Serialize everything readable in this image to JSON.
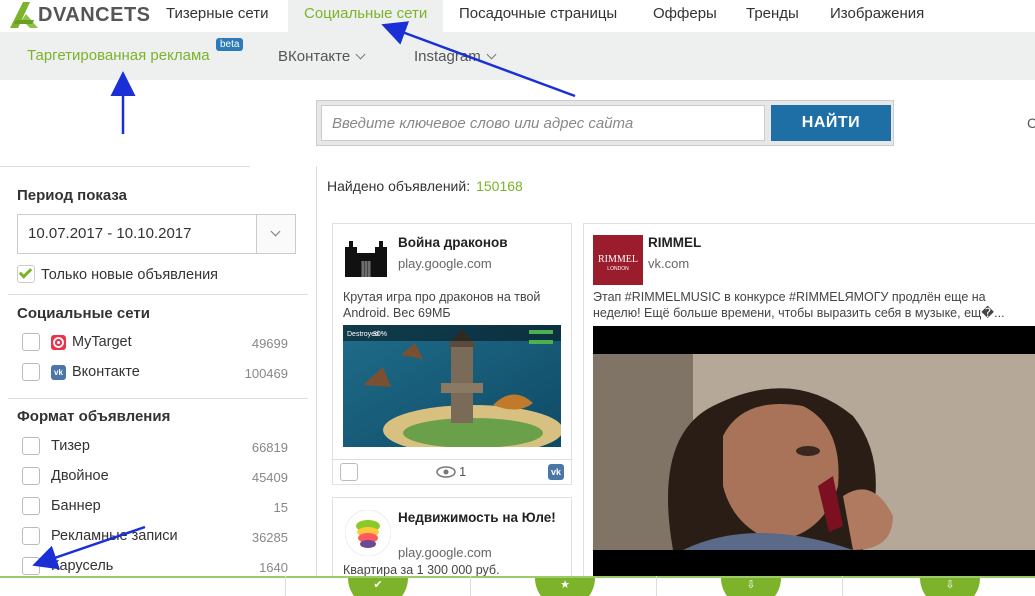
{
  "app": {
    "logo_letter": "A",
    "logo_rest": "DVANCETS"
  },
  "topnav": {
    "tabs": [
      "Тизерные сети",
      "Социальные сети",
      "Посадочные страницы",
      "Офферы",
      "Тренды",
      "Изображения"
    ],
    "active_index": 1
  },
  "subnav": {
    "items": [
      "Таргетированная реклама",
      "ВКонтакте",
      "Instagram"
    ],
    "badge": "beta"
  },
  "search": {
    "placeholder": "Введите ключевое слово или адрес сайта",
    "button": "НАЙТИ"
  },
  "edge_char": "С",
  "sidebar": {
    "period_title": "Период показа",
    "date_range": "10.07.2017 - 10.10.2017",
    "only_new_label": "Только новые объявления",
    "networks_title": "Социальные сети",
    "networks": [
      {
        "label": "MyTarget",
        "count": "49699",
        "icon": "mytarget-icon",
        "color": "#e8334a"
      },
      {
        "label": "Вконтакте",
        "count": "100469",
        "icon": "vk-icon",
        "color": "#4a76a8"
      }
    ],
    "format_title": "Формат объявления",
    "formats": [
      {
        "label": "Тизер",
        "count": "66819"
      },
      {
        "label": "Двойное",
        "count": "45409"
      },
      {
        "label": "Баннер",
        "count": "15"
      },
      {
        "label": "Рекламные записи",
        "count": "36285"
      },
      {
        "label": "Карусель",
        "count": "1640"
      }
    ]
  },
  "results": {
    "label": "Найдено объявлений:",
    "count": "150168"
  },
  "cards": [
    {
      "title": "Война драконов",
      "domain": "play.google.com",
      "text": "Крутая игра про драконов на твой Android. Вес 69МБ",
      "views": "1",
      "icon": "castle-icon"
    },
    {
      "title": "RIMMEL",
      "domain": "vk.com",
      "text": "Этап #RIMMELMUSIC в конкурсе #RIMMELЯМОГУ продлён еще на неделю! Ещё больше времени, чтобы выразить себя в музыке, ещ�...",
      "logo_text": "RIMMEL",
      "logo_sub": "LONDON"
    },
    {
      "title": "Недвижимость на Юле!",
      "domain": "play.google.com",
      "text": "Квартира за 1 300 000 руб."
    }
  ],
  "game_hud": {
    "label": "Destroyed",
    "pct": "30%"
  },
  "colors": {
    "accent": "#7cb32b",
    "button": "#1e6fa5",
    "vk": "#4a76a8",
    "mytarget": "#e8334a",
    "arrow": "#1a2fd6"
  }
}
